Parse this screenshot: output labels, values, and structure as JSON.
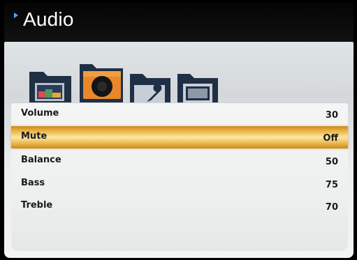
{
  "header": {
    "title": "Audio"
  },
  "tabs": [
    {
      "icon": "picture-folder-icon",
      "selected": false
    },
    {
      "icon": "audio-folder-icon",
      "selected": true
    },
    {
      "icon": "setup-folder-icon",
      "selected": false
    },
    {
      "icon": "screen-folder-icon",
      "selected": false
    }
  ],
  "menu": {
    "items": [
      {
        "label": "Volume",
        "value": "30"
      },
      {
        "label": "Mute",
        "value": "Off"
      },
      {
        "label": "Balance",
        "value": "50"
      },
      {
        "label": "Bass",
        "value": "75"
      },
      {
        "label": "Treble",
        "value": "70"
      }
    ],
    "selected_index": 1
  },
  "colors": {
    "highlight": "#e9b13f",
    "audio_tab": "#e8882a",
    "folder": "#1f2f45",
    "header_arrow": "#4fa6ff"
  }
}
